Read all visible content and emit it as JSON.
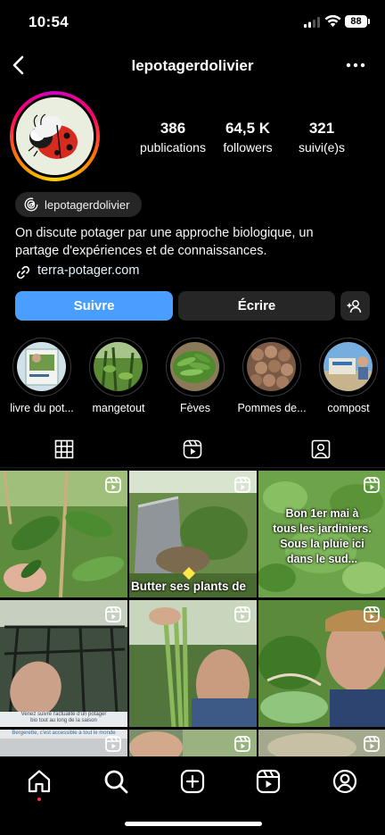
{
  "status_bar": {
    "time": "10:54",
    "battery": "88",
    "icons": [
      "signal-icon",
      "wifi-icon",
      "battery-icon"
    ]
  },
  "header": {
    "username": "lepotagerdolivier",
    "back_icon": "back-chevron-icon",
    "more_icon": "more-dots-icon"
  },
  "profile": {
    "stats": [
      {
        "value": "386",
        "label": "publications"
      },
      {
        "value": "64,5 K",
        "label": "followers"
      },
      {
        "value": "321",
        "label": "suivi(e)s"
      }
    ],
    "threads_handle": "lepotagerdolivier",
    "bio_line1": "On discute potager par une approche biologique, un",
    "bio_line2": "partage d'expériences et de connaissances.",
    "link": "terra-potager.com"
  },
  "actions": {
    "follow": "Suivre",
    "message": "Écrire",
    "add_user_icon": "add-user-icon"
  },
  "highlights": [
    {
      "label": "livre du pot..."
    },
    {
      "label": "mangetout"
    },
    {
      "label": "Fèves"
    },
    {
      "label": "Pommes de..."
    },
    {
      "label": "compost"
    }
  ],
  "tabs": [
    "grid-icon",
    "reels-icon",
    "tagged-icon"
  ],
  "grid": {
    "captions": {
      "p2": "Butter ses plants de",
      "p3_line1": "Bon 1er mai à",
      "p3_line2": "tous les jardiniers.",
      "p3_line3": "Sous la pluie ici",
      "p3_line4": "dans le sud...",
      "p4_line1": "Venez suivre l'actualité d'un potager",
      "p4_line2": "bio tout au long de la saison",
      "p4_line3": "Bergerette, c'est accessible à tout le monde"
    }
  },
  "bottom_nav": [
    "home-icon",
    "search-icon",
    "create-icon",
    "reels-icon",
    "profile-icon"
  ],
  "colors": {
    "accent": "#4a9eff",
    "background": "#000000",
    "button_dark": "#262626"
  }
}
